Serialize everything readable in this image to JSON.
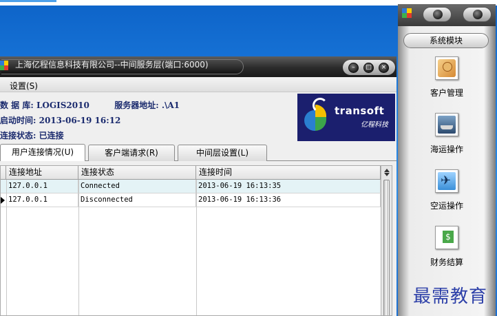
{
  "window": {
    "title": "上海亿程信息科技有限公司--中间服务层(端口:6000)"
  },
  "menu": {
    "settings_label": "设置(S)"
  },
  "info": {
    "database_label": "数 据 库:",
    "database_value": "LOGIS2010",
    "server_label": "服务器地址:",
    "server_value": ".\\A1",
    "start_time_label": "启动时间:",
    "start_time_value": "2013-06-19 16:12",
    "status_label": "连接状态:",
    "status_value": "已连接"
  },
  "logo": {
    "brand": "transoft",
    "brand_cn": "亿程科技"
  },
  "tabs": [
    {
      "label": "用户连接情况(U)",
      "active": true
    },
    {
      "label": "客户端请求(R)",
      "active": false
    },
    {
      "label": "中间层设置(L)",
      "active": false
    }
  ],
  "grid": {
    "columns": [
      "连接地址",
      "连接状态",
      "连接时间"
    ],
    "rows": [
      {
        "address": "127.0.0.1",
        "status": "Connected",
        "time": "2013-06-19 16:13:35",
        "current": false
      },
      {
        "address": "127.0.0.1",
        "status": "Disconnected",
        "time": "2013-06-19 16:13:36",
        "current": true
      }
    ]
  },
  "side_panel": {
    "header": "系统模块",
    "modules": [
      {
        "label": "客户管理",
        "icon": "customer-icon"
      },
      {
        "label": "海运操作",
        "icon": "ship-icon"
      },
      {
        "label": "空运操作",
        "icon": "airplane-icon"
      },
      {
        "label": "财务结算",
        "icon": "finance-icon"
      }
    ]
  },
  "watermark": "最需教育",
  "colors": {
    "desktop_blue": "#1e7ee0",
    "info_text": "#1b2b6e",
    "selected_row": "#e4f3f6",
    "logo_bg": "#1b1f6e"
  }
}
